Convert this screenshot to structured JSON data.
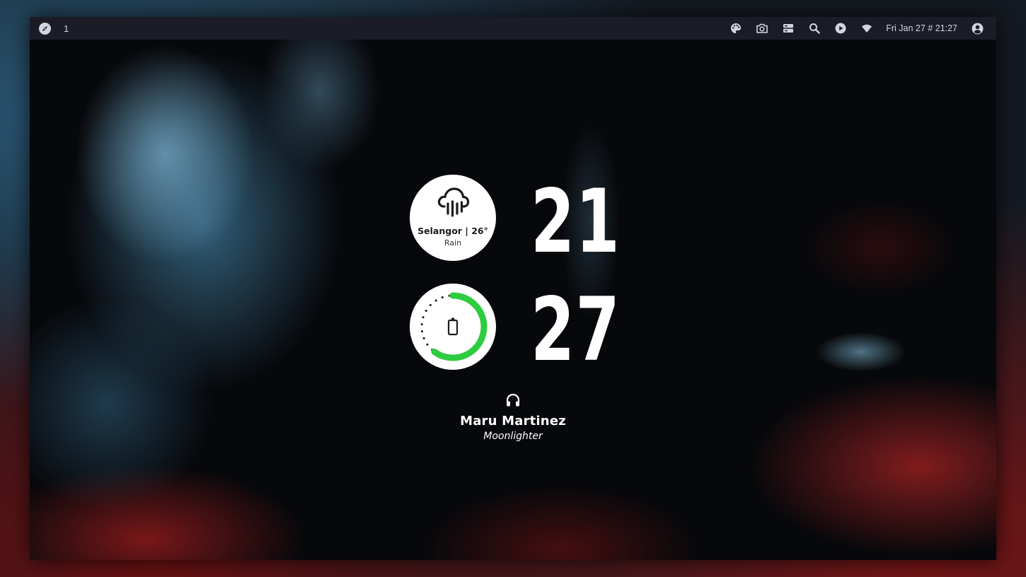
{
  "topbar": {
    "launcher_icon": "compass-icon",
    "workspace": "1",
    "tray_icons": [
      "palette-icon",
      "camera-icon",
      "server-icon",
      "search-icon",
      "play-icon",
      "wifi-icon"
    ],
    "datetime": "Fri Jan 27 # 21:27",
    "user_icon": "user-circle-icon",
    "background_color": "#1c1c27"
  },
  "weather": {
    "icon": "cloud-rain-icon",
    "location_temp": "Selangor | 26°",
    "condition": "Rain"
  },
  "battery": {
    "icon": "battery-icon",
    "level": 0.6,
    "ring_color": "#2ecc40"
  },
  "clock": {
    "hour": "21",
    "minute": "27"
  },
  "music": {
    "icon": "headphones-icon",
    "artist": "Maru Martinez",
    "track": "Moonlighter"
  }
}
